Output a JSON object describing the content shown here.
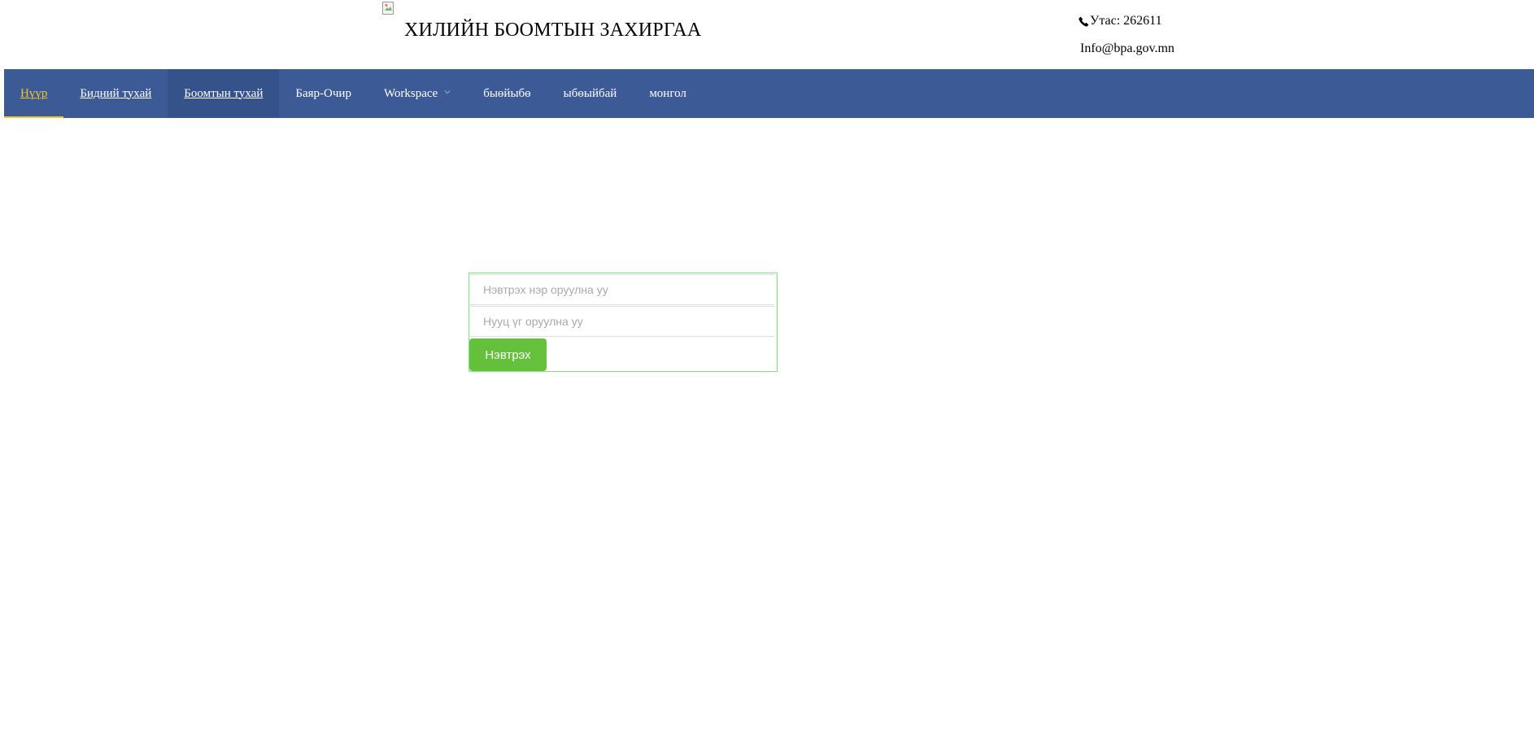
{
  "header": {
    "logo_icon": "broken-image-icon",
    "title": "ХИЛИЙН БООМТЫН ЗАХИРГАА",
    "phone_icon": "phone-icon",
    "phone": "Утас: 262611",
    "email": "Info@bpa.gov.mn"
  },
  "nav": {
    "items": [
      {
        "label": "Нүүр",
        "active": true,
        "underline": true
      },
      {
        "label": "Бидний тухай",
        "underline": true
      },
      {
        "label": "Боомтын тухай",
        "underline": true,
        "hovered": true
      },
      {
        "label": "Баяр-Очир"
      },
      {
        "label": "Workspace",
        "dropdown": true
      },
      {
        "label": "быөйыбө"
      },
      {
        "label": "ыбөыйбай"
      },
      {
        "label": "монгол"
      }
    ]
  },
  "login": {
    "username_placeholder": "Нэвтрэх нэр оруулна уу",
    "password_placeholder": "Нууц үг оруулна уу",
    "submit_label": "Нэвтрэх"
  },
  "colors": {
    "nav_bg": "#3c5a96",
    "nav_active": "#f3c623",
    "button_bg": "#65c03c",
    "form_border": "#7be87b"
  }
}
